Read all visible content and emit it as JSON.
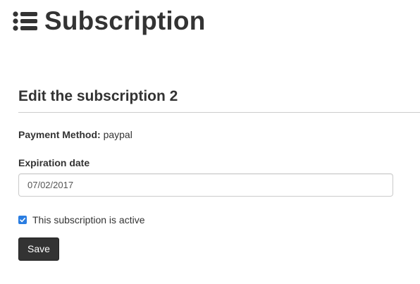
{
  "header": {
    "title": "Subscription",
    "icon": "list-icon"
  },
  "form": {
    "heading": "Edit the subscription 2",
    "payment_method_label": "Payment Method:",
    "payment_method_value": "paypal",
    "expiration_label": "Expiration date",
    "expiration_value": "07/02/2017",
    "active_checked": true,
    "active_label": "This subscription is active",
    "save_label": "Save"
  },
  "colors": {
    "text": "#333333",
    "checkbox_accent": "#2a7de1",
    "button_bg": "#333333",
    "button_text": "#ffffff",
    "divider": "#cccccc"
  }
}
